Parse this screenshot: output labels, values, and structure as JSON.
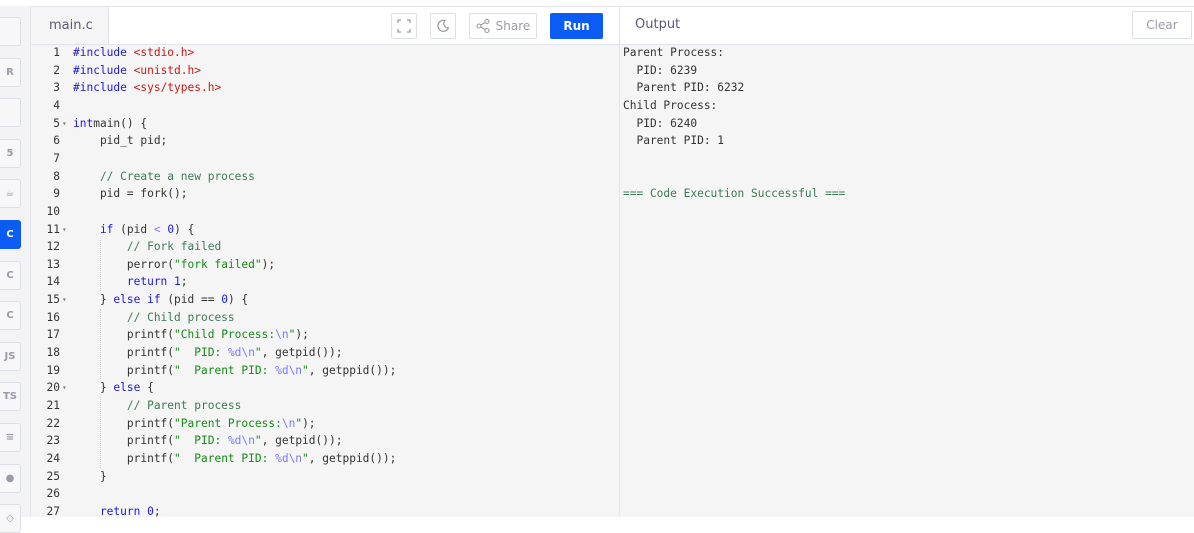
{
  "sidebar": {
    "items": [
      {
        "icon": "python-icon",
        "label": ""
      },
      {
        "icon": "r-icon",
        "label": "R"
      },
      {
        "icon": "database-icon",
        "label": ""
      },
      {
        "icon": "html5-icon",
        "label": "5"
      },
      {
        "icon": "java-icon",
        "label": "☕"
      },
      {
        "icon": "c-icon",
        "label": "C",
        "active": true
      },
      {
        "icon": "cpp-icon",
        "label": "C"
      },
      {
        "icon": "csharp-icon",
        "label": "C"
      },
      {
        "icon": "javascript-icon",
        "label": "JS"
      },
      {
        "icon": "typescript-icon",
        "label": "TS"
      },
      {
        "icon": "sql-icon",
        "label": "≡"
      },
      {
        "icon": "go-icon",
        "label": "●"
      },
      {
        "icon": "swift-icon",
        "label": "◇"
      }
    ]
  },
  "editor": {
    "tab": "main.c",
    "share_label": "Share",
    "run_label": "Run",
    "lines": [
      [
        [
          "kw",
          "#include "
        ],
        [
          "inc",
          "<stdio.h>"
        ]
      ],
      [
        [
          "kw",
          "#include "
        ],
        [
          "inc",
          "<unistd.h>"
        ]
      ],
      [
        [
          "kw",
          "#include "
        ],
        [
          "inc",
          "<sys/types.h>"
        ]
      ],
      [],
      [
        [
          "kw",
          "int"
        ],
        [
          "",
          "main() {"
        ]
      ],
      [
        [
          "",
          "    pid_t pid;"
        ]
      ],
      [],
      [
        [
          "cm",
          "    // Create a new process"
        ]
      ],
      [
        [
          "",
          "    pid = fork();"
        ]
      ],
      [],
      [
        [
          "kw",
          "    if"
        ],
        [
          "",
          " (pid "
        ],
        [
          "esc",
          "<"
        ],
        [
          "",
          " "
        ],
        [
          "num2",
          "0"
        ],
        [
          "",
          ") {"
        ]
      ],
      [
        [
          "cm",
          "        // Fork failed"
        ]
      ],
      [
        [
          "",
          "        perror("
        ],
        [
          "str",
          "\"fork failed\""
        ],
        [
          "",
          ");"
        ]
      ],
      [
        [
          "kw",
          "        return "
        ],
        [
          "num2",
          "1"
        ],
        [
          "",
          ";"
        ]
      ],
      [
        [
          "",
          "    } "
        ],
        [
          "kw",
          "else if"
        ],
        [
          "",
          " (pid == "
        ],
        [
          "num2",
          "0"
        ],
        [
          "",
          ") {"
        ]
      ],
      [
        [
          "cm",
          "        // Child process"
        ]
      ],
      [
        [
          "",
          "        printf("
        ],
        [
          "str",
          "\"Child Process:"
        ],
        [
          "esc",
          "\\n"
        ],
        [
          "str",
          "\""
        ],
        [
          "",
          ");"
        ]
      ],
      [
        [
          "",
          "        printf("
        ],
        [
          "str",
          "\"  PID: "
        ],
        [
          "esc",
          "%d\\n"
        ],
        [
          "str",
          "\""
        ],
        [
          "",
          ", getpid());"
        ]
      ],
      [
        [
          "",
          "        printf("
        ],
        [
          "str",
          "\"  Parent PID: "
        ],
        [
          "esc",
          "%d\\n"
        ],
        [
          "str",
          "\""
        ],
        [
          "",
          ", getppid());"
        ]
      ],
      [
        [
          "",
          "    } "
        ],
        [
          "kw",
          "else"
        ],
        [
          "",
          " {"
        ]
      ],
      [
        [
          "cm",
          "        // Parent process"
        ]
      ],
      [
        [
          "",
          "        printf("
        ],
        [
          "str",
          "\"Parent Process:"
        ],
        [
          "esc",
          "\\n"
        ],
        [
          "str",
          "\""
        ],
        [
          "",
          ");"
        ]
      ],
      [
        [
          "",
          "        printf("
        ],
        [
          "str",
          "\"  PID: "
        ],
        [
          "esc",
          "%d\\n"
        ],
        [
          "str",
          "\""
        ],
        [
          "",
          ", getpid());"
        ]
      ],
      [
        [
          "",
          "        printf("
        ],
        [
          "str",
          "\"  Parent PID: "
        ],
        [
          "esc",
          "%d\\n"
        ],
        [
          "str",
          "\""
        ],
        [
          "",
          ", getppid());"
        ]
      ],
      [
        [
          "",
          "    }"
        ]
      ],
      [],
      [
        [
          "kw",
          "    return "
        ],
        [
          "num2",
          "0"
        ],
        [
          "",
          ";"
        ]
      ]
    ],
    "fold_lines": [
      5,
      11,
      15,
      20
    ]
  },
  "output": {
    "title": "Output",
    "clear_label": "Clear",
    "lines": [
      "Parent Process:",
      "  PID: 6239",
      "  Parent PID: 6232",
      "Child Process:",
      "  PID: 6240",
      "  Parent PID: 1",
      "",
      "",
      "=== Code Execution Successful ==="
    ]
  },
  "colors": {
    "accent": "#0a5cf5"
  }
}
